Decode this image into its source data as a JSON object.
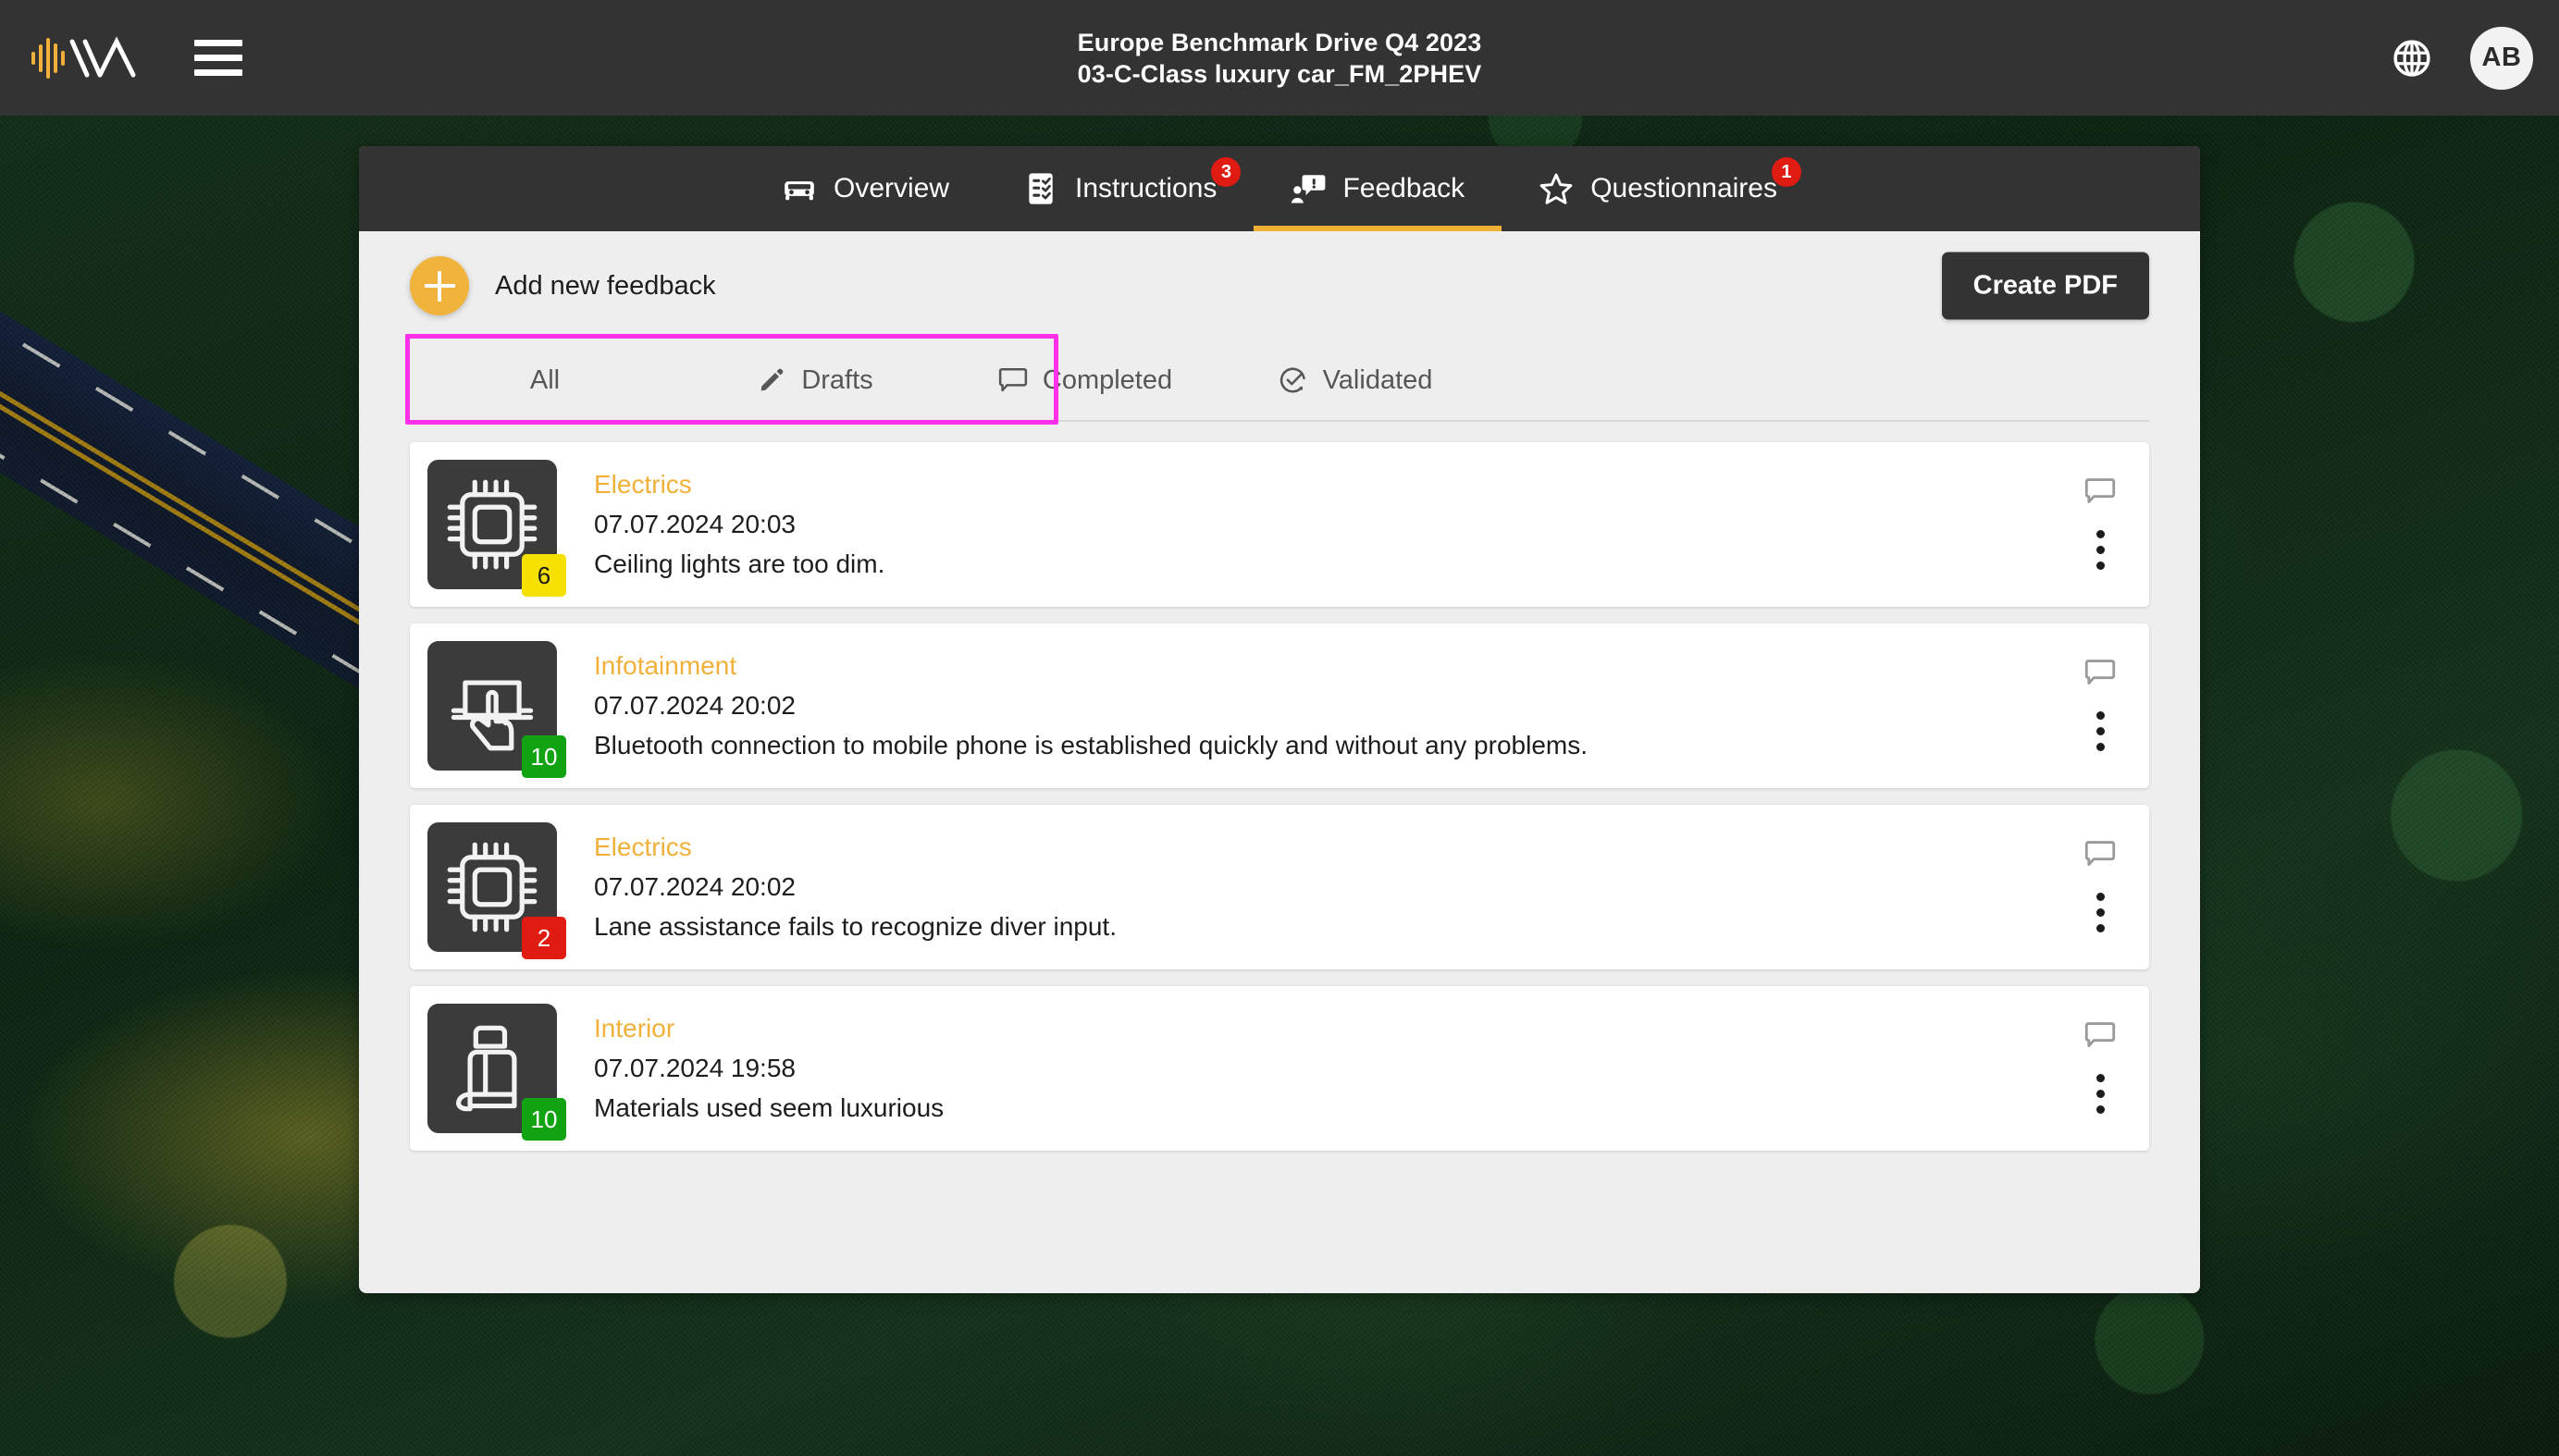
{
  "header": {
    "logo_name": "waveform-chevron-logo",
    "menu_icon": "hamburger-menu-icon",
    "title_line1": "Europe Benchmark Drive Q4 2023",
    "title_line2": "03-C-Class luxury car_FM_2PHEV",
    "language_icon": "globe-icon",
    "avatar_initials": "AB"
  },
  "tabs": [
    {
      "label": "Overview",
      "icon": "car-icon",
      "badge": "",
      "active": false
    },
    {
      "label": "Instructions",
      "icon": "checklist-icon",
      "badge": "3",
      "active": false
    },
    {
      "label": "Feedback",
      "icon": "feedback-icon",
      "badge": "",
      "active": true
    },
    {
      "label": "Questionnaires",
      "icon": "star-icon",
      "badge": "1",
      "active": false
    }
  ],
  "toolbar": {
    "add_icon": "plus-icon",
    "add_label": "Add new feedback",
    "create_pdf_label": "Create PDF"
  },
  "filters": [
    {
      "label": "All",
      "icon": "",
      "selected": true
    },
    {
      "label": "Drafts",
      "icon": "pencil-icon",
      "selected": false
    },
    {
      "label": "Completed",
      "icon": "comment-icon",
      "selected": false
    },
    {
      "label": "Validated",
      "icon": "check-circle-icon",
      "selected": false
    }
  ],
  "filter_highlight_color": "#ff30e8",
  "accent_color": "#f0b03a",
  "cards": [
    {
      "icon": "microchip-icon",
      "category": "Electrics",
      "date": "07.07.2024 20:03",
      "message": "Ceiling lights are too dim.",
      "score": "6",
      "score_color": "yellow",
      "comment_icon": "comment-icon",
      "menu_icon": "kebab-menu-icon"
    },
    {
      "icon": "touchscreen-hand-icon",
      "category": "Infotainment",
      "date": "07.07.2024 20:02",
      "message": "Bluetooth connection to mobile phone is established quickly and without any problems.",
      "score": "10",
      "score_color": "green",
      "comment_icon": "comment-icon",
      "menu_icon": "kebab-menu-icon"
    },
    {
      "icon": "microchip-icon",
      "category": "Electrics",
      "date": "07.07.2024 20:02",
      "message": "Lane assistance fails to recognize diver input.",
      "score": "2",
      "score_color": "red",
      "comment_icon": "comment-icon",
      "menu_icon": "kebab-menu-icon"
    },
    {
      "icon": "car-seat-icon",
      "category": "Interior",
      "date": "07.07.2024 19:58",
      "message": "Materials used seem luxurious",
      "score": "10",
      "score_color": "green",
      "comment_icon": "comment-icon",
      "menu_icon": "kebab-menu-icon"
    }
  ]
}
